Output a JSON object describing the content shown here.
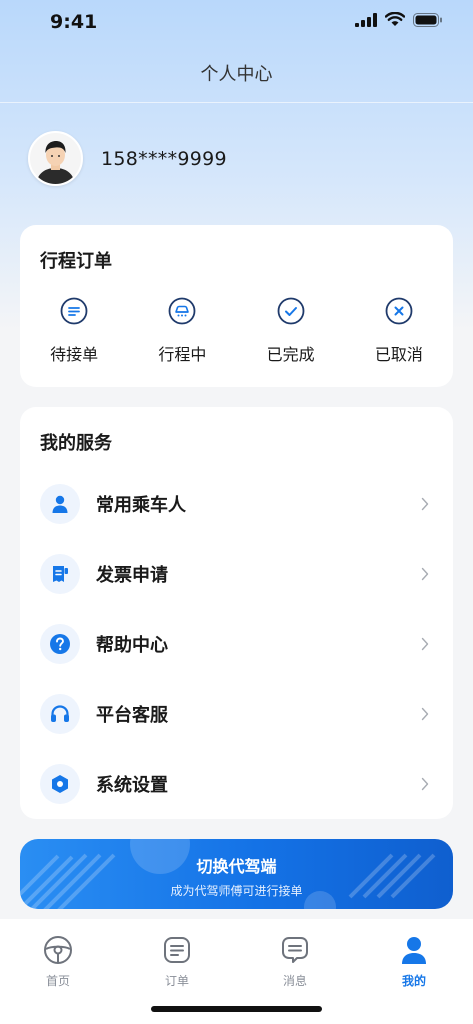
{
  "status_bar": {
    "time": "9:41"
  },
  "nav": {
    "title": "个人中心"
  },
  "profile": {
    "phone": "158****9999"
  },
  "trip_orders": {
    "title": "行程订单",
    "items": [
      {
        "label": "待接单",
        "icon": "list-circle-icon"
      },
      {
        "label": "行程中",
        "icon": "car-circle-icon"
      },
      {
        "label": "已完成",
        "icon": "check-circle-icon"
      },
      {
        "label": "已取消",
        "icon": "x-circle-icon"
      }
    ]
  },
  "services": {
    "title": "我的服务",
    "items": [
      {
        "label": "常用乘车人",
        "icon": "person-icon"
      },
      {
        "label": "发票申请",
        "icon": "invoice-icon"
      },
      {
        "label": "帮助中心",
        "icon": "question-icon"
      },
      {
        "label": "平台客服",
        "icon": "headset-icon"
      },
      {
        "label": "系统设置",
        "icon": "settings-hex-icon"
      }
    ]
  },
  "switch_banner": {
    "title": "切换代驾端",
    "subtitle": "成为代驾师傅可进行接单"
  },
  "tab_bar": {
    "tabs": [
      {
        "label": "首页",
        "icon": "steering-wheel-icon",
        "active": false
      },
      {
        "label": "订单",
        "icon": "order-list-icon",
        "active": false
      },
      {
        "label": "消息",
        "icon": "message-icon",
        "active": false
      },
      {
        "label": "我的",
        "icon": "user-icon",
        "active": true
      }
    ]
  },
  "colors": {
    "accent": "#1677e8",
    "tab_inactive": "#8a8f99"
  }
}
